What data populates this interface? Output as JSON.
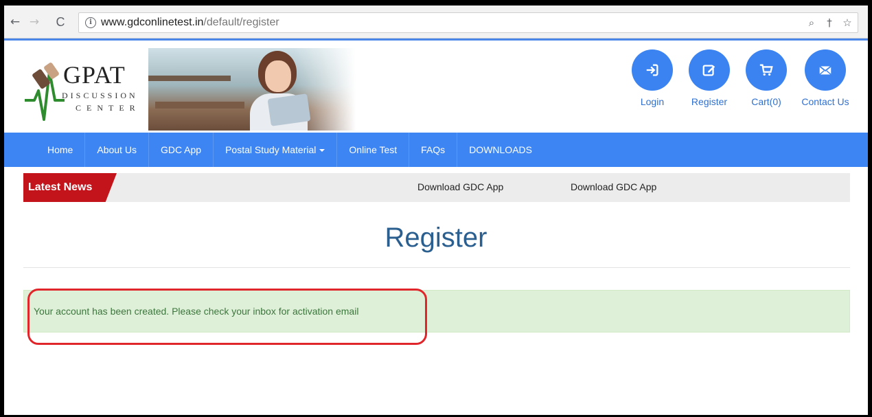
{
  "browser": {
    "url_host": "www.gdconlinetest.in",
    "url_path": "/default/register",
    "back_glyph": "←",
    "forward_glyph": "→",
    "reload_glyph": "C",
    "icons": [
      "zoom-icon",
      "key-icon",
      "star-icon"
    ]
  },
  "logo": {
    "title": "GPAT",
    "line1": "DISCUSSION",
    "line2": "CENTER"
  },
  "header_actions": [
    {
      "label": "Login",
      "icon": "login-icon"
    },
    {
      "label": "Register",
      "icon": "edit-icon"
    },
    {
      "label": "Cart(0)",
      "icon": "cart-icon"
    },
    {
      "label": "Contact Us",
      "icon": "envelope-icon"
    }
  ],
  "nav": {
    "items": [
      "Home",
      "About Us",
      "GDC App",
      "Postal Study Material",
      "Online Test",
      "FAQs",
      "DOWNLOADS"
    ]
  },
  "ticker": {
    "label": "Latest News",
    "items": [
      "Download GDC App",
      "Download GDC App"
    ]
  },
  "main": {
    "title": "Register",
    "alert": "Your account has been created. Please check your inbox for activation email"
  },
  "colors": {
    "brand_blue": "#3d85f2",
    "news_red": "#c4141b",
    "alert_green_bg": "#dff0d8",
    "alert_green_text": "#3c763d",
    "highlight_red": "#e0262a"
  }
}
